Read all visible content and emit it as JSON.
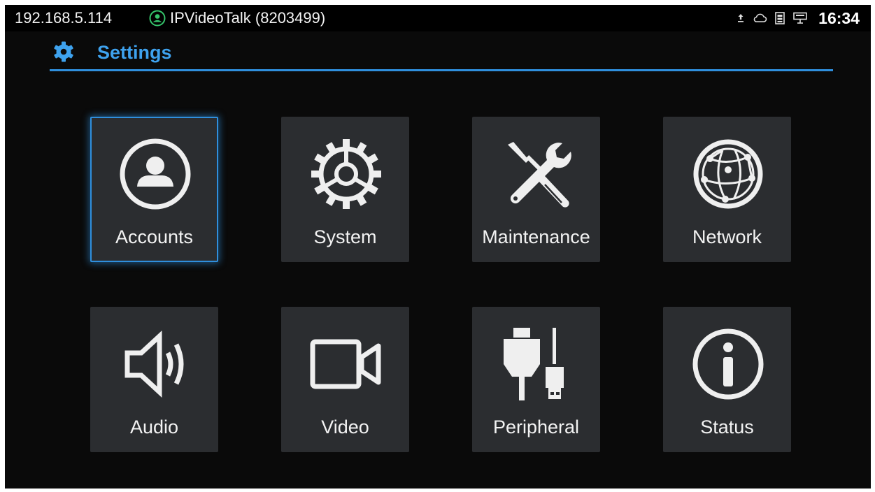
{
  "statusbar": {
    "ip": "192.168.5.114",
    "account": "IPVideoTalk (8203499)",
    "time": "16:34",
    "icons": [
      "upload-icon",
      "cloud-icon",
      "sim-icon",
      "ethernet-icon"
    ]
  },
  "header": {
    "title": "Settings",
    "accent_color": "#3ea2ee"
  },
  "tiles": [
    {
      "label": "Accounts",
      "icon": "account-icon",
      "selected": true
    },
    {
      "label": "System",
      "icon": "gear-icon",
      "selected": false
    },
    {
      "label": "Maintenance",
      "icon": "tools-icon",
      "selected": false
    },
    {
      "label": "Network",
      "icon": "globe-icon",
      "selected": false
    },
    {
      "label": "Audio",
      "icon": "speaker-icon",
      "selected": false
    },
    {
      "label": "Video",
      "icon": "video-camera-icon",
      "selected": false
    },
    {
      "label": "Peripheral",
      "icon": "usb-icon",
      "selected": false
    },
    {
      "label": "Status",
      "icon": "info-icon",
      "selected": false
    }
  ]
}
